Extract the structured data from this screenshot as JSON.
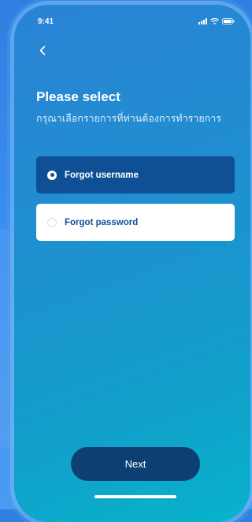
{
  "status_bar": {
    "time": "9:41",
    "icons": [
      "signal-icon",
      "wifi-icon",
      "battery-icon"
    ]
  },
  "nav": {
    "back_icon": "chevron-left-icon"
  },
  "header": {
    "title": "Please select",
    "subtitle": "กรุณาเลือกรายการที่ท่านต้องการทำรายการ"
  },
  "options": [
    {
      "label": "Forgot username",
      "selected": true
    },
    {
      "label": "Forgot password",
      "selected": false
    }
  ],
  "footer": {
    "next_label": "Next"
  },
  "colors": {
    "selected_option_bg": "#0f4f95",
    "next_button_bg": "#0d3f72",
    "unselected_option_bg": "#ffffff"
  }
}
